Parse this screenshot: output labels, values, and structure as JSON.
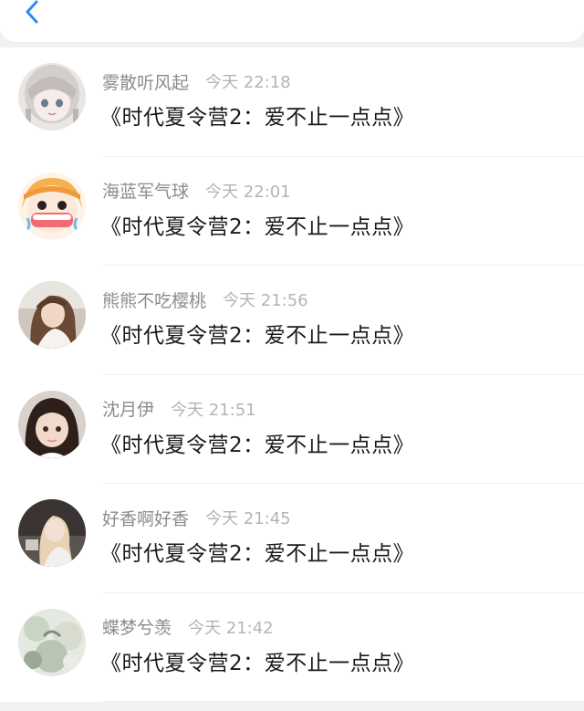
{
  "header": {
    "back_icon": "chevron-left-icon",
    "accent_color": "#2a8cf0"
  },
  "comments": [
    {
      "name": "雾散听风起",
      "time": "今天 22:18",
      "message": "《时代夏令营2：爱不止一点点》",
      "avatar": "anime-girl-gray-hair"
    },
    {
      "name": "海蓝军气球",
      "time": "今天 22:01",
      "message": "《时代夏令营2：爱不止一点点》",
      "avatar": "anime-girl-crying"
    },
    {
      "name": "熊熊不吃樱桃",
      "time": "今天 21:56",
      "message": "《时代夏令营2：爱不止一点点》",
      "avatar": "photo-girl-long-hair"
    },
    {
      "name": "沈月伊",
      "time": "今天 21:51",
      "message": "《时代夏令营2：爱不止一点点》",
      "avatar": "photo-child-dark-hair"
    },
    {
      "name": "好香啊好香",
      "time": "今天 21:45",
      "message": "《时代夏令营2：爱不止一点点》",
      "avatar": "photo-girl-blonde"
    },
    {
      "name": "蝶梦兮羡",
      "time": "今天 21:42",
      "message": "《时代夏令营2：爱不止一点点》",
      "avatar": "photo-scenery-pastel"
    }
  ]
}
